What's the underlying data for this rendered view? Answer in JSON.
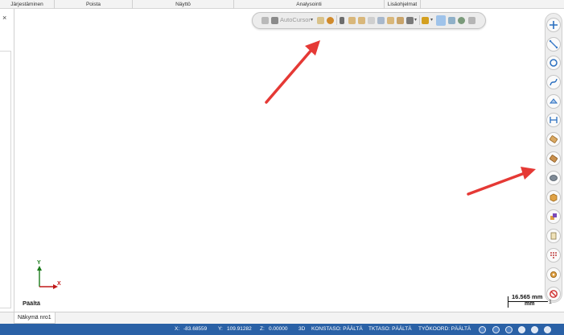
{
  "ribbon": {
    "tabs": [
      {
        "label": "Järjestäminen"
      },
      {
        "label": "Poista"
      },
      {
        "label": "Näyttö"
      },
      {
        "label": "Analysointi"
      },
      {
        "label": "Lisäohjelmat"
      }
    ]
  },
  "left_panel": {
    "close_symbol": "×"
  },
  "floating_toolbar": {
    "autocursor_label": "AutoCursor",
    "dropdown_symbol": "▾"
  },
  "viewport": {
    "axis_y": "Y",
    "axis_x": "X",
    "view_name": "Päältä",
    "scale_value": "16.565 mm",
    "scale_unit": "mm",
    "scale_bracket": "1"
  },
  "view_tabs": [
    {
      "label": "Näkymä nro1"
    }
  ],
  "status_bar": {
    "x_label": "X:",
    "x_value": "-83.68559",
    "y_label": "Y:",
    "y_value": "109.91282",
    "z_label": "Z:",
    "z_value": "0.00000",
    "mode": "3D",
    "konstaso": "KONSTASO: PÄÄLTÄ",
    "tktaso": "TKTASO: PÄÄLTÄ",
    "tyokoord": "TYÖKOORD: PÄÄLTÄ"
  },
  "right_toolbar": {
    "icons": [
      "point-icon",
      "line-icon",
      "circle-icon",
      "spline-icon",
      "shape-icon",
      "dimension-icon",
      "transfer-icon",
      "transfer-icon-2",
      "mesh-icon",
      "cube-icon",
      "layers-icon",
      "clipboard-icon",
      "grid-icon",
      "gear-icon",
      "no-entry-icon"
    ]
  },
  "colors": {
    "status_bar": "#2a61a6",
    "annotation_arrow": "#e53935",
    "axis_y": "#1a7a1a",
    "axis_x": "#c01818"
  }
}
